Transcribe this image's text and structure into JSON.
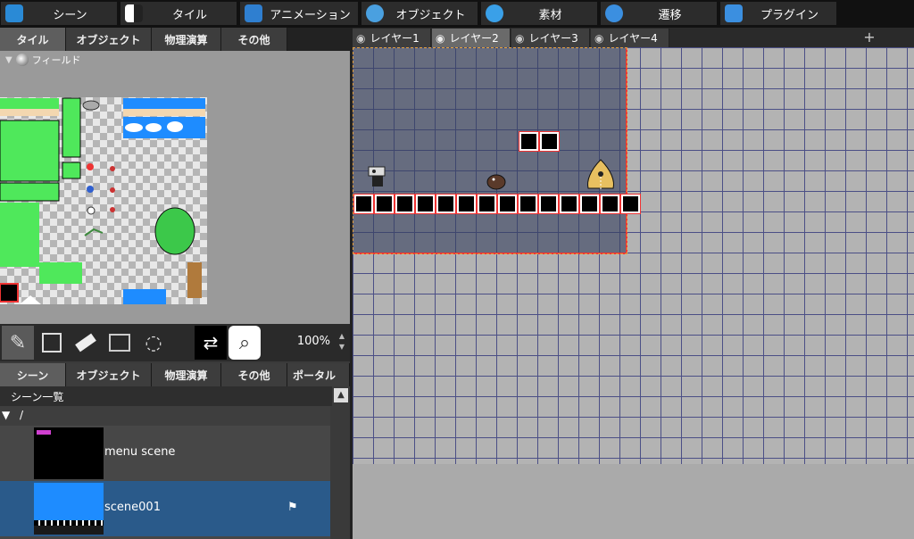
{
  "top_tabs": [
    {
      "label": "シーン",
      "icon": "scene-icon",
      "color": "#2a8ad6"
    },
    {
      "label": "タイル",
      "icon": "tile-icon",
      "color": "#f0f0f0"
    },
    {
      "label": "アニメーション",
      "icon": "animation-icon",
      "color": "#2f7fd0"
    },
    {
      "label": "オブジェクト",
      "icon": "object-icon",
      "color": "#4aa0e0"
    },
    {
      "label": "素材",
      "icon": "material-icon",
      "color": "#3aa0e8"
    },
    {
      "label": "遷移",
      "icon": "transition-icon",
      "color": "#3b8fe0"
    },
    {
      "label": "プラグイン",
      "icon": "plugin-icon",
      "color": "#3b8fe0"
    }
  ],
  "upper_tabs": [
    "タイル",
    "オブジェクト",
    "物理演算",
    "その他"
  ],
  "field_label": "フィールド",
  "zoom": "100%",
  "lower_tabs": [
    "シーン",
    "オブジェクト",
    "物理演算",
    "その他",
    "ポータル"
  ],
  "scene_list_title": "シーン一覧",
  "scene_folder": "/",
  "scenes": [
    {
      "name": "menu scene",
      "selected": false
    },
    {
      "name": "scene001",
      "selected": true
    }
  ],
  "layers": [
    "レイヤー1",
    "レイヤー2",
    "レイヤー3",
    "レイヤー4"
  ],
  "active_layer": 1,
  "add_layer_label": "+",
  "colors": {
    "accent": "#2a5a8a",
    "grid_line": "#4b4f86",
    "scene_border": "#e33333"
  }
}
